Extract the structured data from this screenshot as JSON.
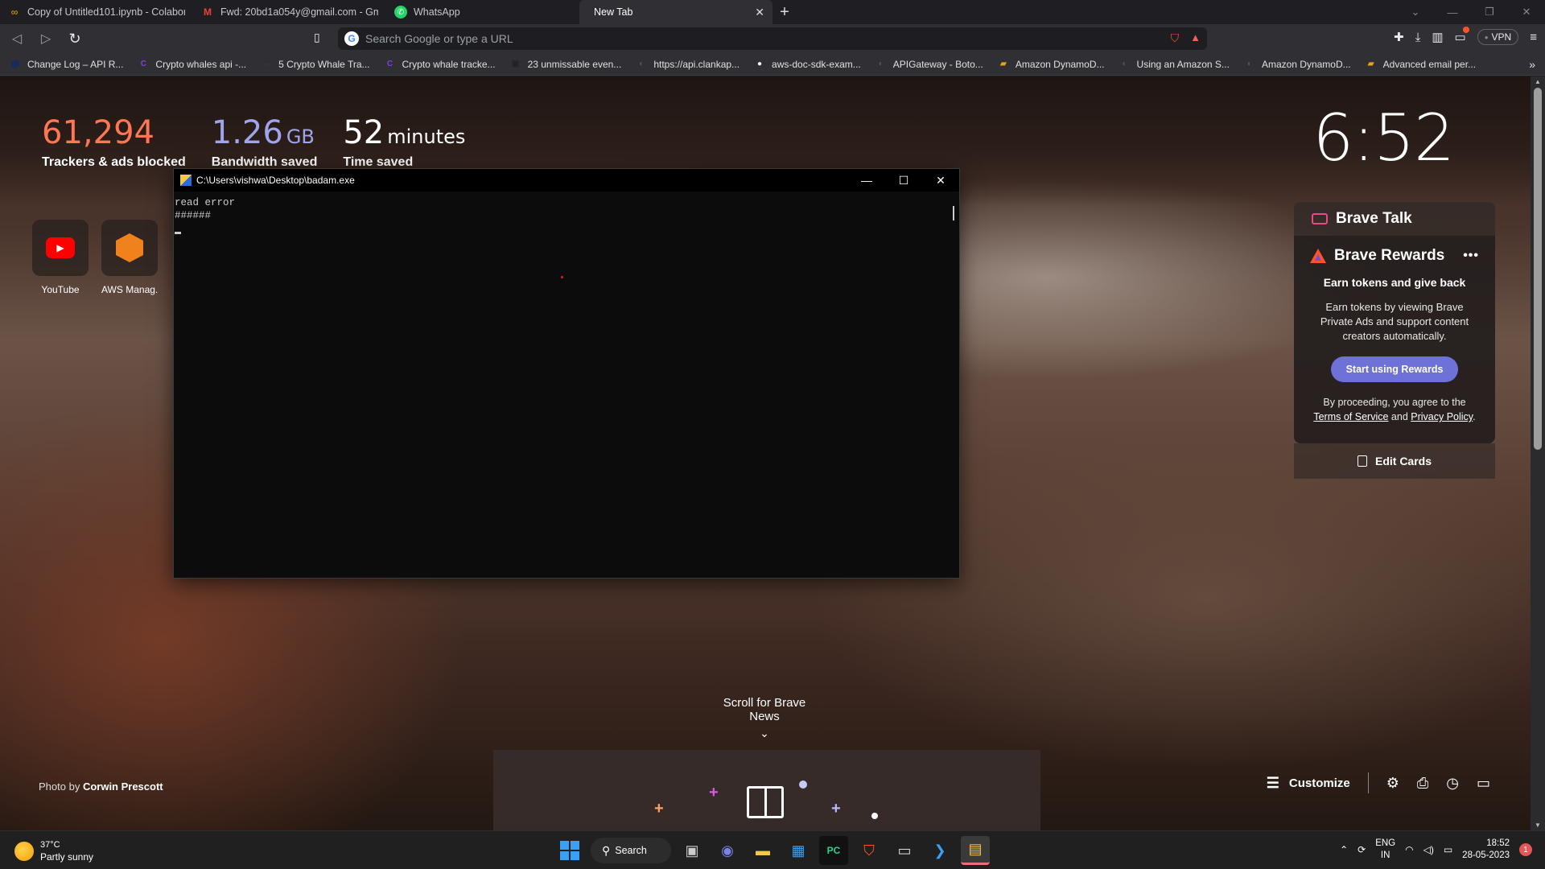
{
  "tabs": [
    {
      "title": "Copy of Untitled101.ipynb - Colaborat",
      "icon": "colab-icon"
    },
    {
      "title": "Fwd: 20bd1a054y@gmail.com - Gma",
      "icon": "gmail-icon"
    },
    {
      "title": "WhatsApp",
      "icon": "whatsapp-icon"
    },
    {
      "title": "New Tab",
      "icon": "",
      "active": true
    }
  ],
  "omnibox": {
    "placeholder": "Search Google or type a URL"
  },
  "toolbar": {
    "vpn_label": "VPN"
  },
  "bookmarks": [
    {
      "label": "Change Log – API R...",
      "color": "#1a2b5a",
      "glyph": "⬤"
    },
    {
      "label": "Crypto whales api -...",
      "color": "#7b3fe4",
      "glyph": "C"
    },
    {
      "label": "5 Crypto Whale Tra...",
      "color": "#333333",
      "glyph": "▬"
    },
    {
      "label": "Crypto whale tracke...",
      "color": "#7b3fe4",
      "glyph": "C"
    },
    {
      "label": "23 unmissable even...",
      "color": "#222222",
      "glyph": "▣"
    },
    {
      "label": "https://api.clankap...",
      "color": "#555555",
      "glyph": "◐"
    },
    {
      "label": "aws-doc-sdk-exam...",
      "color": "#ffffff",
      "glyph": "●"
    },
    {
      "label": "APIGateway - Boto...",
      "color": "#555555",
      "glyph": "◐"
    },
    {
      "label": "Amazon DynamoD...",
      "color": "#e8a317",
      "glyph": "▰"
    },
    {
      "label": "Using an Amazon S...",
      "color": "#555555",
      "glyph": "◐"
    },
    {
      "label": "Amazon DynamoD...",
      "color": "#555555",
      "glyph": "◐"
    },
    {
      "label": "Advanced email per...",
      "color": "#e8a317",
      "glyph": "▰"
    }
  ],
  "stats": {
    "trackers": {
      "value": "61,294",
      "label": "Trackers & ads blocked"
    },
    "bandwidth": {
      "value": "1.26",
      "unit": "GB",
      "label": "Bandwidth saved"
    },
    "time": {
      "value": "52",
      "unit": "minutes",
      "label": "Time saved"
    }
  },
  "clock": "6:52",
  "top_sites": [
    {
      "label": "YouTube",
      "icon": "youtube-icon"
    },
    {
      "label": "AWS Manag...",
      "icon": "aws-icon"
    }
  ],
  "brave_talk": {
    "title": "Brave Talk"
  },
  "rewards": {
    "title": "Brave Rewards",
    "subtitle": "Earn tokens and give back",
    "body": "Earn tokens by viewing Brave Private Ads and support content creators automatically.",
    "button": "Start using Rewards",
    "legal_prefix": "By proceeding, you agree to the ",
    "terms": "Terms of Service",
    "and": " and ",
    "privacy": "Privacy Policy",
    "period": "."
  },
  "edit_cards": "Edit Cards",
  "scroll_news": "Scroll for Brave News",
  "photo_credit": {
    "prefix": "Photo by ",
    "author": "Corwin Prescott"
  },
  "customize": "Customize",
  "console": {
    "title": "C:\\Users\\vishwa\\Desktop\\badam.exe",
    "lines": "read error\n######"
  },
  "taskbar": {
    "temperature": "37°C",
    "condition": "Partly sunny",
    "search": "Search",
    "lang1": "ENG",
    "lang2": "IN",
    "time": "18:52",
    "date": "28-05-2023",
    "notifications": "1"
  },
  "colors": {
    "brave_orange": "#fb542b",
    "rewards_purple": "#6d71d8",
    "trackers": "#ff7654",
    "bandwidth": "#a0a5eb"
  }
}
